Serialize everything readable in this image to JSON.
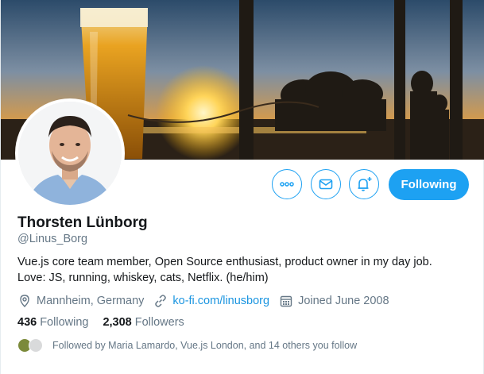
{
  "profile": {
    "name": "Thorsten Lünborg",
    "handle": "@Linus_Borg",
    "bio_line1": "Vue.js core team member, Open Source enthusiast, product owner in my day job.",
    "bio_line2": "Love: JS, running, whiskey, cats, Netflix. (he/him)",
    "location": "Mannheim, Germany",
    "website": "ko-fi.com/linusborg",
    "joined": "Joined June 2008"
  },
  "stats": {
    "following_count": "436",
    "following_label": "Following",
    "followers_count": "2,308",
    "followers_label": "Followers"
  },
  "followed_by": "Followed by Maria Lamardo, Vue.js London, and 14 others you follow",
  "actions": {
    "more_icon": "more-icon",
    "message_icon": "envelope-icon",
    "notify_icon": "bell-plus-icon",
    "follow_label": "Following"
  },
  "colors": {
    "accent": "#1da1f2",
    "link": "#1b95e0",
    "muted": "#657786"
  }
}
